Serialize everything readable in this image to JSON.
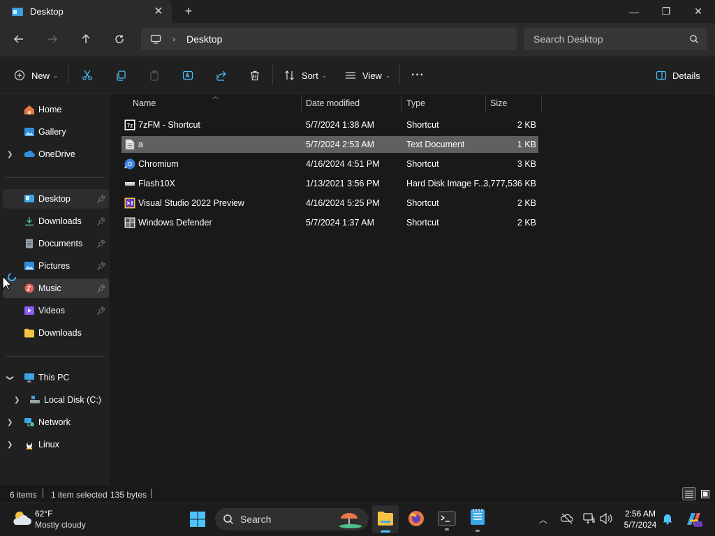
{
  "window": {
    "tab_title": "Desktop",
    "minimize": "—",
    "maximize": "❐",
    "close": "✕"
  },
  "address": {
    "location": "Desktop",
    "search_placeholder": "Search Desktop"
  },
  "toolbar": {
    "new_label": "New",
    "sort_label": "Sort",
    "view_label": "View",
    "more_label": "···",
    "details_label": "Details"
  },
  "sidebar": {
    "quick": [
      {
        "label": "Home",
        "icon": "home-icon"
      },
      {
        "label": "Gallery",
        "icon": "gallery-icon"
      },
      {
        "label": "OneDrive",
        "icon": "onedrive-icon"
      }
    ],
    "pinned": [
      {
        "label": "Desktop",
        "icon": "desktop-folder-icon"
      },
      {
        "label": "Downloads",
        "icon": "downloads-icon"
      },
      {
        "label": "Documents",
        "icon": "documents-icon"
      },
      {
        "label": "Pictures",
        "icon": "pictures-icon"
      },
      {
        "label": "Music",
        "icon": "music-icon"
      },
      {
        "label": "Videos",
        "icon": "videos-icon"
      },
      {
        "label": "Downloads",
        "icon": "folder-icon"
      }
    ],
    "devices": [
      {
        "label": "This PC",
        "icon": "this-pc-icon"
      },
      {
        "label": "Local Disk (C:)",
        "icon": "local-disk-icon"
      },
      {
        "label": "Network",
        "icon": "network-icon"
      },
      {
        "label": "Linux",
        "icon": "linux-icon"
      }
    ]
  },
  "columns": {
    "name": "Name",
    "date": "Date modified",
    "type": "Type",
    "size": "Size"
  },
  "files": [
    {
      "name": "7zFM - Shortcut",
      "date": "5/7/2024 1:38 AM",
      "type": "Shortcut",
      "size": "2 KB",
      "icon": "7zip-icon"
    },
    {
      "name": "a",
      "date": "5/7/2024 2:53 AM",
      "type": "Text Document",
      "size": "1 KB",
      "icon": "text-file-icon"
    },
    {
      "name": "Chromium",
      "date": "4/16/2024 4:51 PM",
      "type": "Shortcut",
      "size": "3 KB",
      "icon": "chromium-icon"
    },
    {
      "name": "Flash10X",
      "date": "1/13/2021 3:56 PM",
      "type": "Hard Disk Image F...",
      "size": "3,777,536 KB",
      "icon": "disk-image-icon"
    },
    {
      "name": "Visual Studio 2022 Preview",
      "date": "4/16/2024 5:25 PM",
      "type": "Shortcut",
      "size": "2 KB",
      "icon": "visual-studio-icon"
    },
    {
      "name": "Windows Defender",
      "date": "5/7/2024 1:37 AM",
      "type": "Shortcut",
      "size": "2 KB",
      "icon": "windows-defender-icon"
    }
  ],
  "status": {
    "items": "6 items",
    "selected": "1 item selected",
    "bytes": "135 bytes"
  },
  "taskbar": {
    "temperature": "62°F",
    "weather": "Mostly cloudy",
    "search_label": "Search",
    "time": "2:56 AM",
    "date": "5/7/2024"
  },
  "colors": {
    "accent": "#4cc2ff",
    "selection": "#606060",
    "background": "#191919"
  }
}
